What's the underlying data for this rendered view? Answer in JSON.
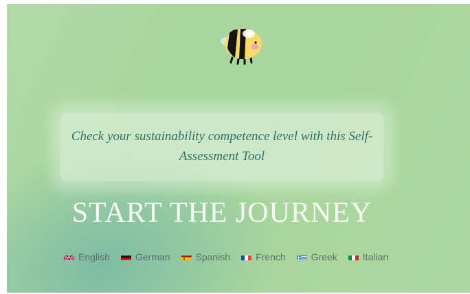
{
  "page": {
    "tagline": "Check your sustainability competence level with this Self-Assessment Tool",
    "start_label": "START THE JOURNEY",
    "colors": {
      "background": "#a9d69d",
      "tagline": "#2f6f6c",
      "start": "#f6faf4",
      "language_text": "#5f6e6b"
    }
  },
  "mascot": {
    "icon": "bee-icon"
  },
  "languages": [
    {
      "label": "English",
      "icon": "uk-flag-icon"
    },
    {
      "label": "German",
      "icon": "germany-flag-icon"
    },
    {
      "label": "Spanish",
      "icon": "spain-flag-icon"
    },
    {
      "label": "French",
      "icon": "france-flag-icon"
    },
    {
      "label": "Greek",
      "icon": "greece-flag-icon"
    },
    {
      "label": "Italian",
      "icon": "italy-flag-icon"
    }
  ]
}
